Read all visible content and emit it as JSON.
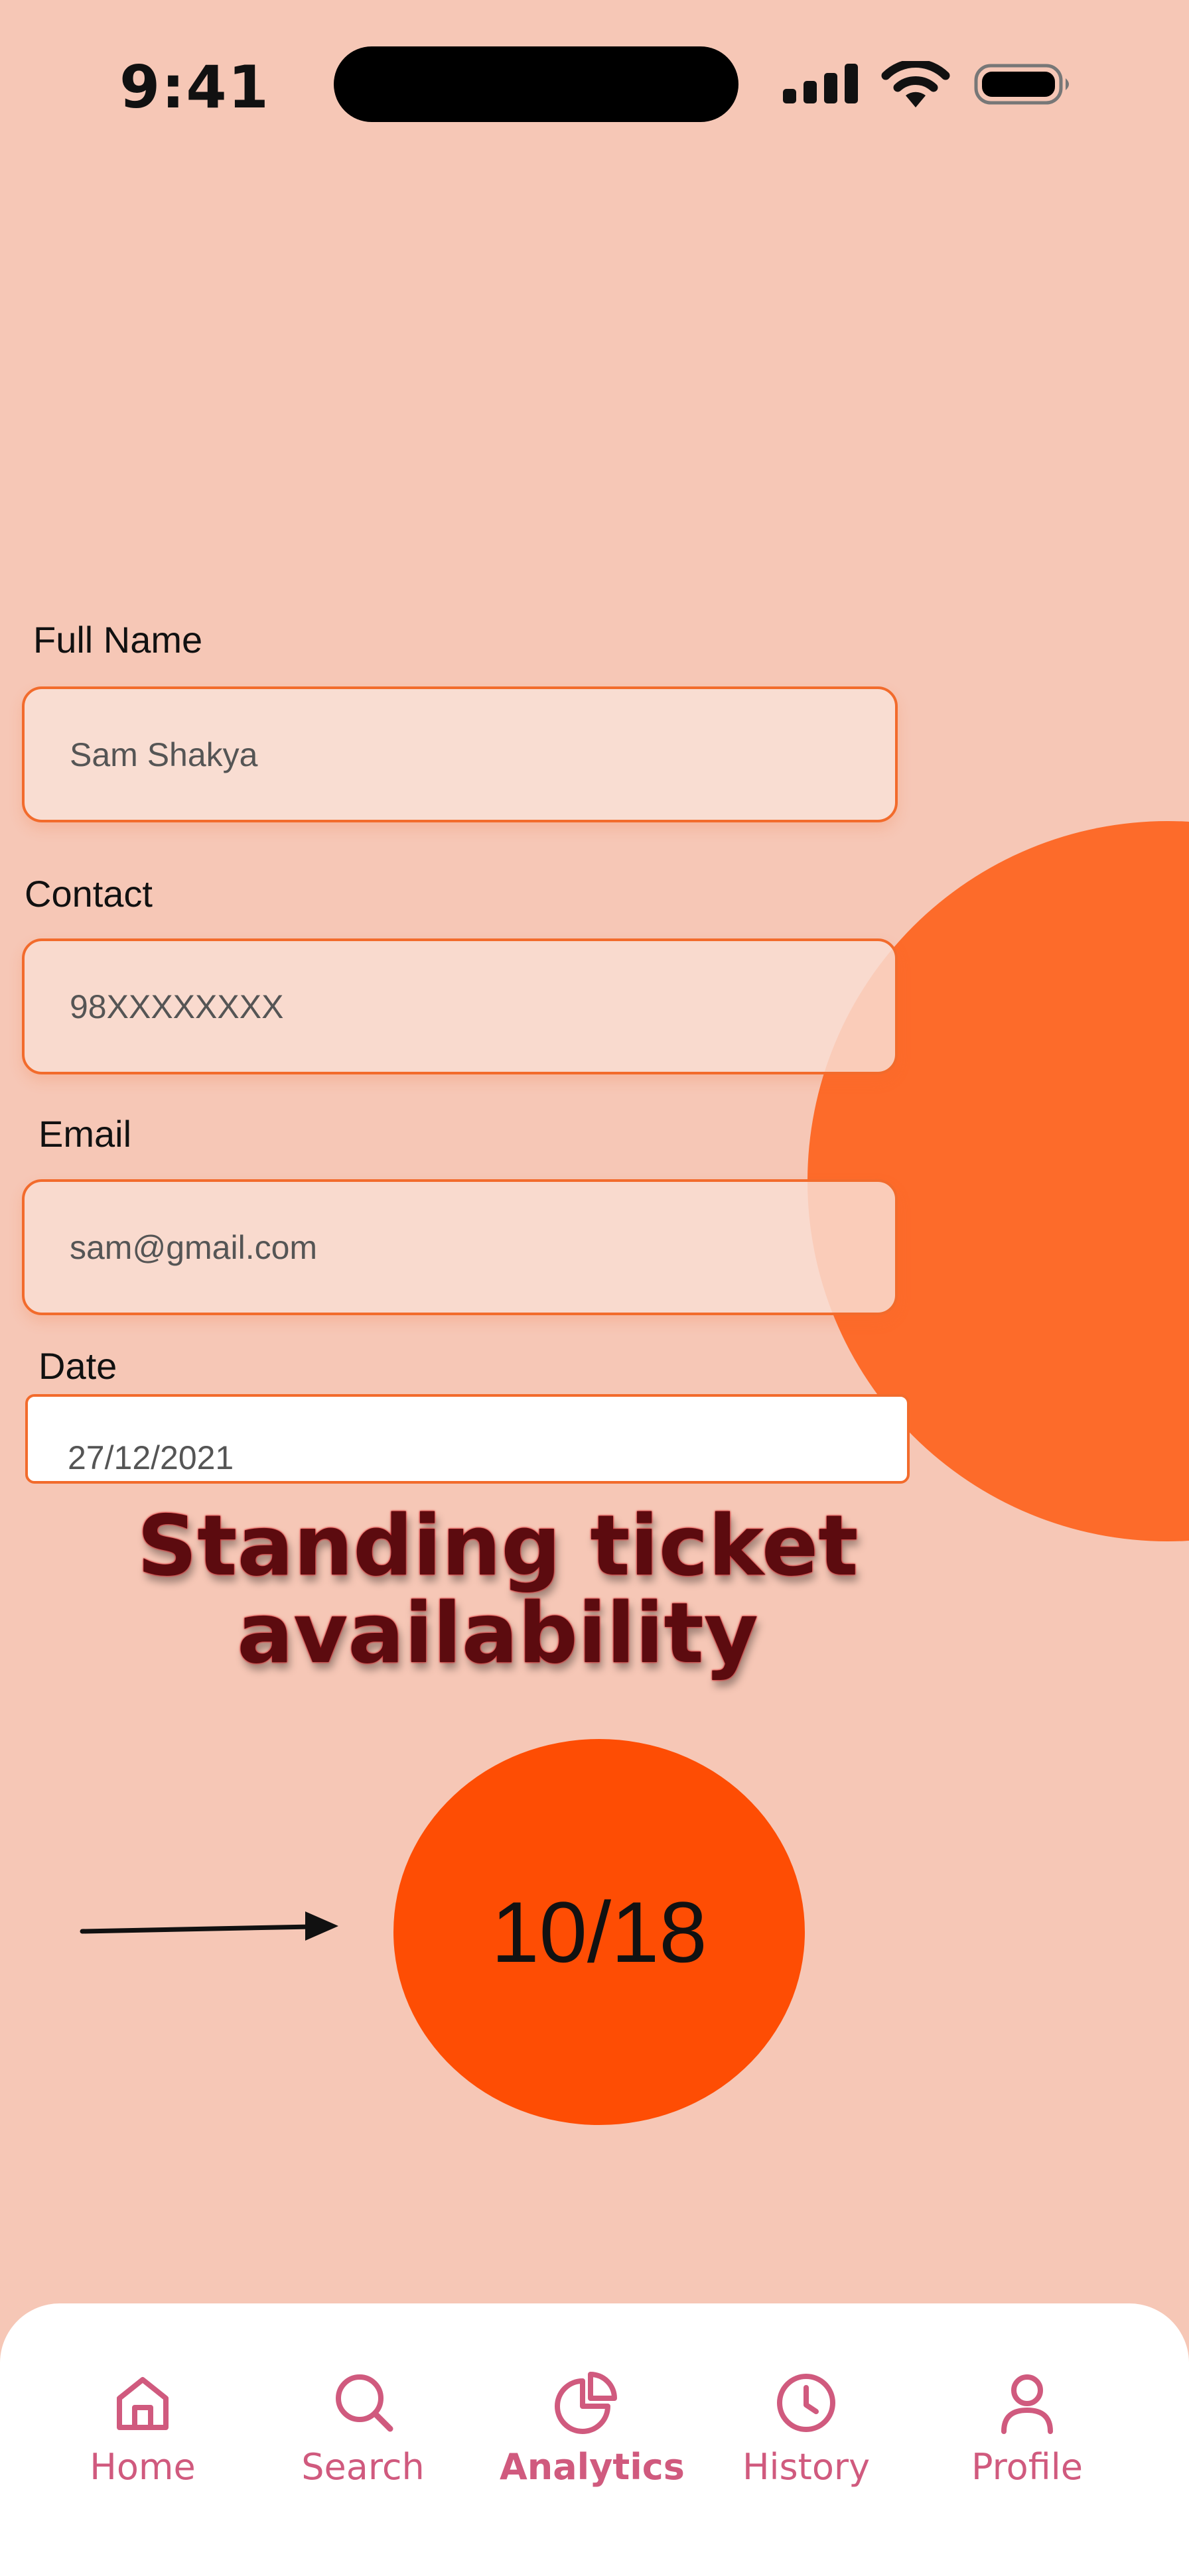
{
  "status_bar": {
    "time": "9:41"
  },
  "form": {
    "full_name": {
      "label": "Full Name",
      "value": "Sam Shakya"
    },
    "contact": {
      "label": "Contact",
      "value": "98XXXXXXXX"
    },
    "email": {
      "label": "Email",
      "value": "sam@gmail.com"
    },
    "date": {
      "label": "Date",
      "value": "27/12/2021"
    }
  },
  "availability": {
    "heading_line1": "Standing ticket",
    "heading_line2": "availability",
    "count": "10/18"
  },
  "bottom_nav": {
    "items": [
      {
        "label": "Home",
        "icon": "home-icon"
      },
      {
        "label": "Search",
        "icon": "search-icon"
      },
      {
        "label": "Analytics",
        "icon": "pie-chart-icon",
        "active": true
      },
      {
        "label": "History",
        "icon": "clock-icon"
      },
      {
        "label": "Profile",
        "icon": "user-icon"
      }
    ]
  },
  "colors": {
    "background": "#f6c7b6",
    "accent": "#fe4d04",
    "field_border": "#f26b2c",
    "nav_icon": "#d05a7e",
    "heading_text": "#5c0b0f"
  }
}
